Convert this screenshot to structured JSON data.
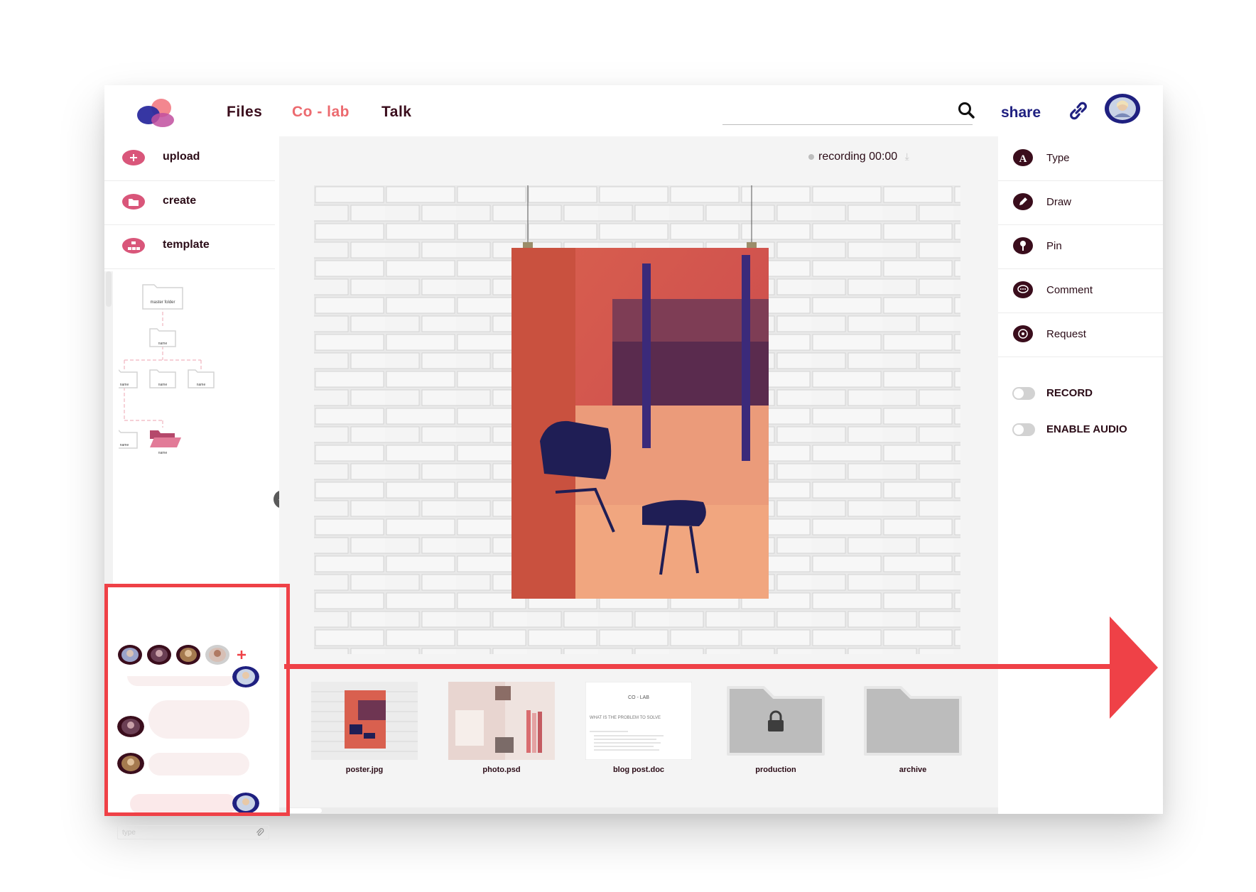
{
  "topbar": {
    "nav": [
      {
        "label": "Files",
        "color": "#2b0c17"
      },
      {
        "label": "Co - lab",
        "color": "#ec6a6f"
      },
      {
        "label": "Talk",
        "color": "#2b0c17"
      }
    ],
    "share_label": "share",
    "accent_color": "#1f2080"
  },
  "left_panel": {
    "items": [
      {
        "label": "upload",
        "icon": "plus-circle-icon"
      },
      {
        "label": "create",
        "icon": "folder-icon"
      },
      {
        "label": "template",
        "icon": "template-icon"
      }
    ],
    "tree": {
      "root": "master folder",
      "nodes": [
        "name",
        "name",
        "name",
        "name",
        "name",
        "name"
      ]
    }
  },
  "chat": {
    "type_placeholder": "type"
  },
  "center": {
    "recording_label": "recording 00:00",
    "thumbnails": [
      {
        "caption": "poster.jpg",
        "kind": "image"
      },
      {
        "caption": "photo.psd",
        "kind": "image"
      },
      {
        "caption": "blog post.doc",
        "kind": "document",
        "doc_title": "CO - LAB",
        "doc_heading": "WHAT IS THE PROBLEM TO SOLVE"
      },
      {
        "caption": "production",
        "kind": "locked-folder"
      },
      {
        "caption": "archive",
        "kind": "folder"
      }
    ]
  },
  "right_panel": {
    "tools": [
      {
        "label": "Type",
        "icon": "type-icon"
      },
      {
        "label": "Draw",
        "icon": "pencil-icon"
      },
      {
        "label": "Pin",
        "icon": "pin-icon"
      },
      {
        "label": "Comment",
        "icon": "comment-icon"
      },
      {
        "label": "Request",
        "icon": "request-icon"
      }
    ],
    "toggles": [
      {
        "label": "RECORD",
        "on": false
      },
      {
        "label": "ENABLE AUDIO",
        "on": false
      }
    ]
  },
  "colors": {
    "primary_dark": "#3a0d1c",
    "pink": "#d9567a",
    "highlight_red": "#ef4147"
  }
}
